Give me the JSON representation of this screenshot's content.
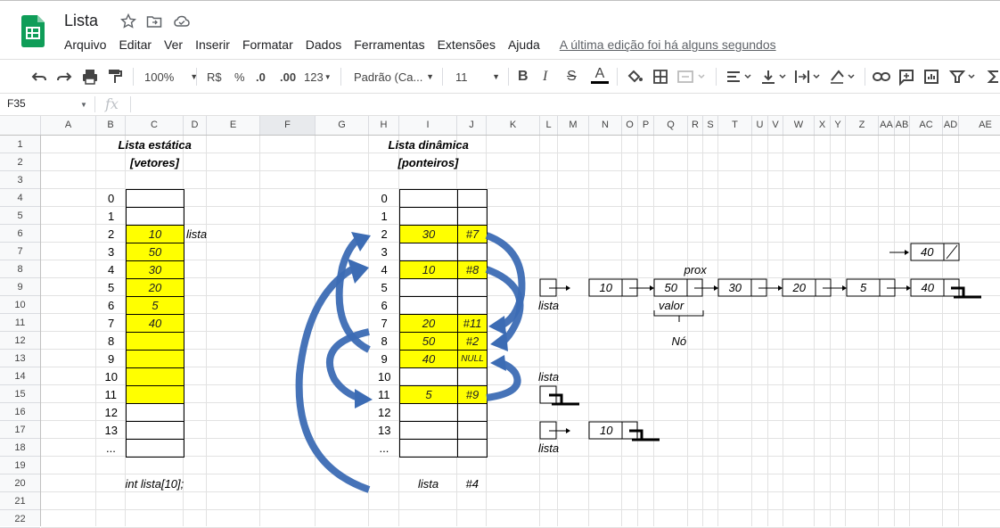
{
  "app": {
    "title": "Lista",
    "menus": [
      "Arquivo",
      "Editar",
      "Ver",
      "Inserir",
      "Formatar",
      "Dados",
      "Ferramentas",
      "Extensões",
      "Ajuda"
    ],
    "last_edit": "A última edição foi há alguns segundos"
  },
  "toolbar": {
    "zoom": "100%",
    "currency": "R$",
    "percent": "%",
    "dec_less": ".0",
    "dec_more": ".00",
    "format_more": "123",
    "font": "Padrão (Ca...",
    "font_size": "11",
    "bold": "B",
    "italic": "I",
    "strike": "S",
    "text_color_letter": "A"
  },
  "formula_bar": {
    "name_box": "F35",
    "fx": "fx"
  },
  "columns": [
    "A",
    "B",
    "C",
    "D",
    "E",
    "F",
    "G",
    "H",
    "I",
    "J",
    "K",
    "L",
    "M",
    "N",
    "O",
    "P",
    "Q",
    "R",
    "S",
    "T",
    "U",
    "V",
    "W",
    "X",
    "Y",
    "Z",
    "AA",
    "AB",
    "AC",
    "AD",
    "AE"
  ],
  "rows": [
    "1",
    "2",
    "3",
    "4",
    "5",
    "6",
    "7",
    "8",
    "9",
    "10",
    "11",
    "12",
    "13",
    "14",
    "15",
    "16",
    "17",
    "18",
    "19",
    "20",
    "21",
    "22"
  ],
  "static_list": {
    "title": "Lista estática",
    "subtitle": "[vetores]",
    "indices": [
      "0",
      "1",
      "2",
      "3",
      "4",
      "5",
      "6",
      "7",
      "8",
      "9",
      "10",
      "11",
      "12",
      "13",
      "..."
    ],
    "values": [
      "",
      "",
      "10",
      "50",
      "30",
      "20",
      "5",
      "40",
      "",
      "",
      "",
      "",
      "",
      "",
      ""
    ],
    "highlighted_rows": [
      2,
      3,
      4,
      5,
      6,
      7,
      8,
      9,
      10,
      11
    ],
    "pointer_label": "lista",
    "declaration": "int lista[10];"
  },
  "dynamic_list": {
    "title": "Lista dinâmica",
    "subtitle": "[ponteiros]",
    "indices": [
      "0",
      "1",
      "2",
      "3",
      "4",
      "5",
      "6",
      "7",
      "8",
      "9",
      "10",
      "11",
      "12",
      "13",
      "..."
    ],
    "values": [
      "",
      "",
      "30",
      "",
      "10",
      "",
      "",
      "20",
      "50",
      "40",
      "",
      "5",
      "",
      "",
      ""
    ],
    "pointers": [
      "",
      "",
      "#7",
      "",
      "#8",
      "",
      "",
      "#11",
      "#2",
      "NULL",
      "",
      "#9",
      "",
      "",
      ""
    ],
    "highlighted_rows": [
      2,
      4,
      7,
      8,
      9,
      11
    ],
    "footer_label": "lista",
    "footer_pointer": "#4"
  },
  "linked_diagram": {
    "main_label": "lista",
    "nodes": [
      "10",
      "50",
      "30",
      "20",
      "5",
      "40"
    ],
    "prox_label": "prox",
    "valor_label": "valor",
    "no_label": "Nó",
    "new_node": "40",
    "empty_list_label": "lista",
    "single_list_label": "lista",
    "single_node": "10"
  },
  "colors": {
    "highlight": "#ffff00",
    "arrow": "#3c6cb4",
    "sheets_green": "#0f9d58"
  }
}
